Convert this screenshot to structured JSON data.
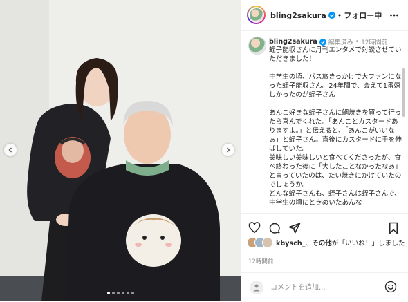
{
  "post": {
    "images": {
      "total": 6,
      "current": 0
    }
  },
  "header": {
    "username": "bling2sakura",
    "separator": "•",
    "follow_label": "フォロー中"
  },
  "caption": {
    "username": "bling2sakura",
    "edited_label": "編集済み",
    "separator": "•",
    "time": "12時間前",
    "text": "蛭子能収さんに月刊エンタメで対談させていただきました！\n\n中学生の頃、バス旅きっかけで大ファンになった蛭子能収さん。24年間で、会えて1番嬉しかったのが蛭子さん\n\nあんこ好きな蛭子さんに鯛焼きを買って行ったら喜んでくれた。「あんことカスタードありますよ。」と伝えると、「あんこがいいなぁ」と蛭子さん。直後にカスタードに手を伸ばしていた。\n美味しい美味しいと食べてくださったが、食べ終わった後に「大したことなかったなあ」と言っていたのは、たい焼きにかけていたのでしょうか。\nどんな蛭子さんも、蛭子さんは蛭子さんで、中学生の頃にときめいたあんな"
  },
  "likes": {
    "user": "kbysch_",
    "connector": "、",
    "others_label": "その他",
    "suffix": "が「いいね！」しました"
  },
  "timestamp": "12時間前",
  "comment": {
    "placeholder": "コメントを追加..."
  },
  "icons": {
    "verified": "verified-badge-icon",
    "more": "more-horizontal-icon",
    "like": "heart-icon",
    "comment": "comment-bubble-icon",
    "share": "paper-plane-icon",
    "save": "bookmark-icon",
    "emoji": "smiley-icon",
    "prev": "chevron-left-icon",
    "next": "chevron-right-icon"
  },
  "colors": {
    "verified_blue": "#0095f6",
    "text": "#262626",
    "muted": "#8e8e8e"
  }
}
